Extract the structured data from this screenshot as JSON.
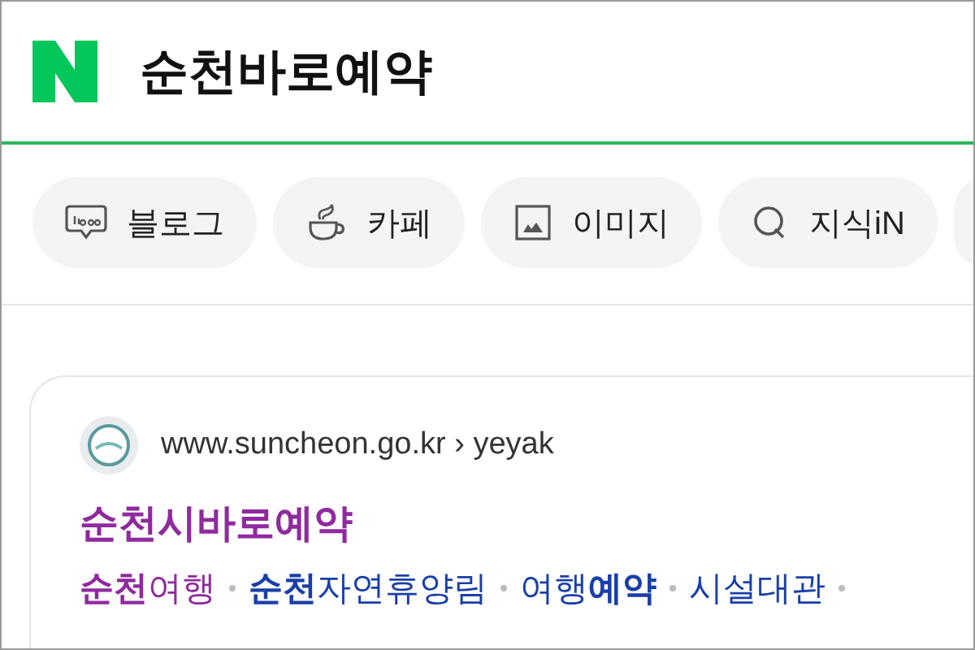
{
  "search": {
    "query": "순천바로예약"
  },
  "tabs": [
    {
      "label": "블로그",
      "kind": "blog"
    },
    {
      "label": "카페",
      "kind": "cafe"
    },
    {
      "label": "이미지",
      "kind": "image"
    },
    {
      "label": "지식iN",
      "kind": "kin"
    }
  ],
  "result": {
    "url": "www.suncheon.go.kr",
    "separator": "›",
    "path": "yeyak",
    "title": "순천시바로예약",
    "title_visited": true,
    "sitelinks": [
      {
        "text": "**순천**여행",
        "visited": true
      },
      {
        "text": "**순천**자연휴양림",
        "visited": false
      },
      {
        "text": "여행**예약**",
        "visited": false
      },
      {
        "text": "시설대관",
        "visited": false
      }
    ]
  }
}
